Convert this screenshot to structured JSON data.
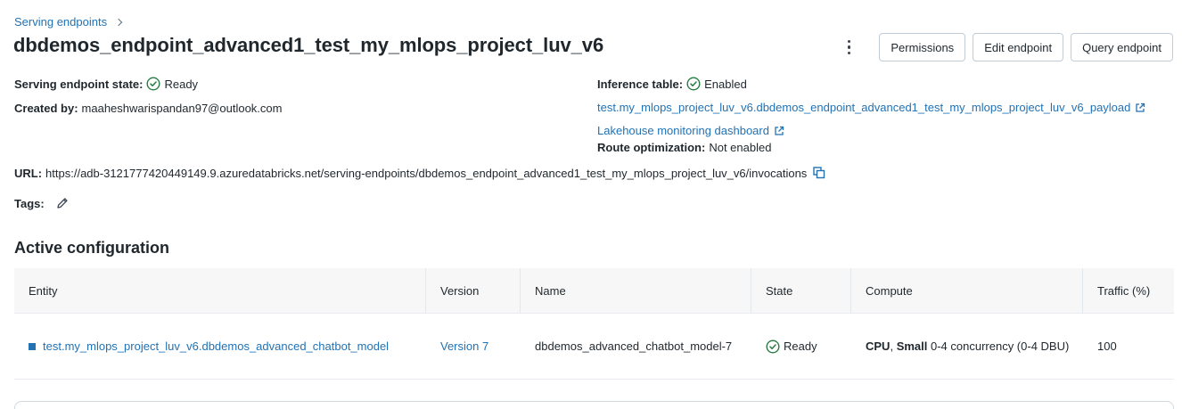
{
  "breadcrumb": {
    "parent": "Serving endpoints"
  },
  "page": {
    "title": "dbdemos_endpoint_advanced1_test_my_mlops_project_luv_v6"
  },
  "actions": {
    "permissions": "Permissions",
    "edit": "Edit endpoint",
    "query": "Query endpoint"
  },
  "details": {
    "state_label": "Serving endpoint state:",
    "state_value": "Ready",
    "created_label": "Created by:",
    "created_value": "maaheshwarispandan97@outlook.com",
    "inference_label": "Inference table:",
    "inference_value": "Enabled",
    "inference_table_link": "test.my_mlops_project_luv_v6.dbdemos_endpoint_advanced1_test_my_mlops_project_luv_v6_payload",
    "monitoring_link": "Lakehouse monitoring dashboard",
    "route_label": "Route optimization:",
    "route_value": "Not enabled",
    "url_label": "URL:",
    "url_value": "https://adb-3121777420449149.9.azuredatabricks.net/serving-endpoints/dbdemos_endpoint_advanced1_test_my_mlops_project_luv_v6/invocations",
    "tags_label": "Tags:"
  },
  "active_config": {
    "title": "Active configuration",
    "columns": [
      "Entity",
      "Version",
      "Name",
      "State",
      "Compute",
      "Traffic (%)"
    ],
    "rows": [
      {
        "entity": "test.my_mlops_project_luv_v6.dbdemos_advanced_chatbot_model",
        "version": "Version 7",
        "name": "dbdemos_advanced_chatbot_model-7",
        "state": "Ready",
        "compute_type": "CPU",
        "compute_sep": ", ",
        "compute_size": "Small",
        "compute_rest": " 0-4 concurrency (0-4 DBU)",
        "traffic": "100"
      }
    ]
  },
  "colors": {
    "link": "#2272b4",
    "success": "#277c43",
    "text": "#1f272d",
    "border": "#c0cdd8"
  }
}
